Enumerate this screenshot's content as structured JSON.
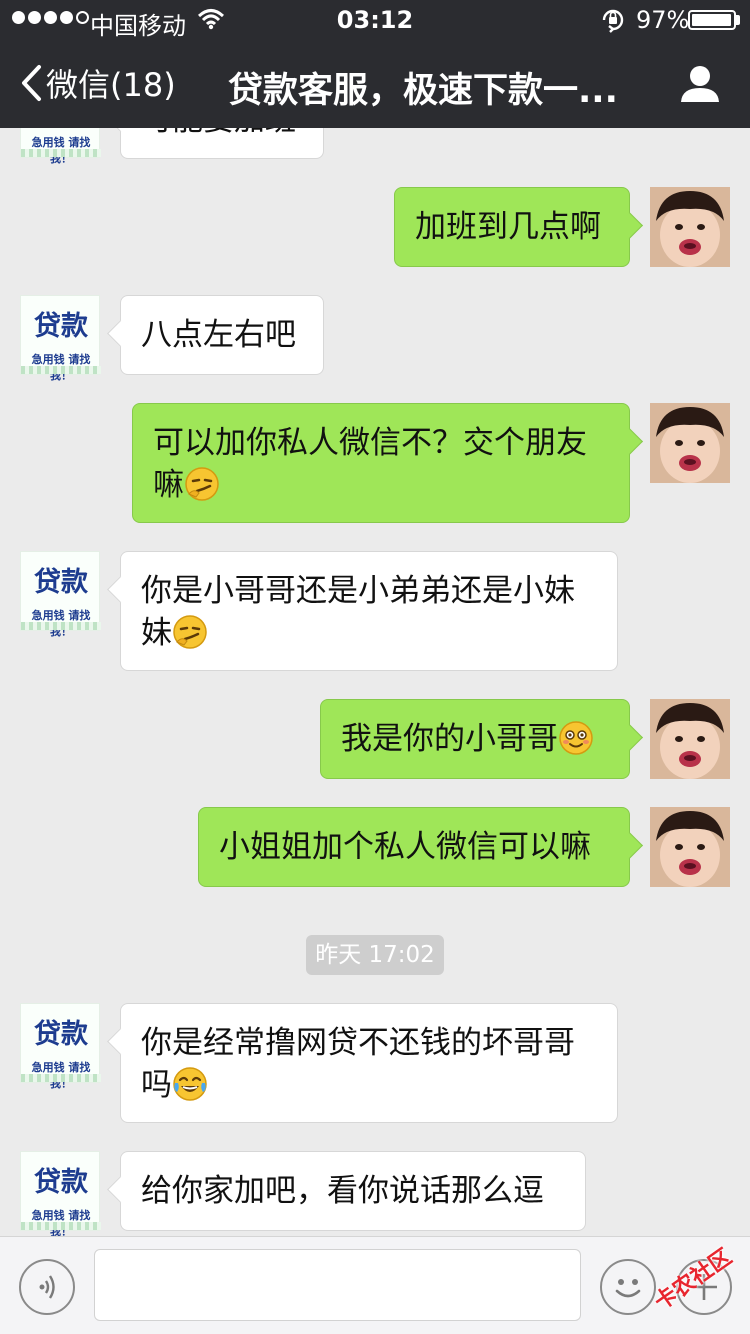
{
  "status_bar": {
    "carrier": "中国移动",
    "time": "03:12",
    "battery_percent": "97%",
    "battery_level": 0.97
  },
  "nav": {
    "back_label": "微信(18)",
    "title": "贷款客服，极速下款一..."
  },
  "loan_avatar": {
    "big_text": "贷款",
    "small_text": "急用钱 请找我！"
  },
  "messages": [
    {
      "side": "left",
      "text": "可能要加班"
    },
    {
      "side": "right",
      "text": "加班到几点啊"
    },
    {
      "side": "left",
      "text": "八点左右吧"
    },
    {
      "side": "right",
      "text": "可以加你私人微信不？交个朋友嘛",
      "emoji": "smirk-emoji"
    },
    {
      "side": "left",
      "text": "你是小哥哥还是小弟弟还是小妹妹",
      "emoji": "smirk-emoji"
    },
    {
      "side": "right",
      "text": "我是你的小哥哥",
      "emoji": "blush-emoji"
    },
    {
      "side": "right",
      "text": "小姐姐加个私人微信可以嘛"
    },
    {
      "side": "left",
      "text": "你是经常撸网贷不还钱的坏哥哥吗",
      "emoji": "tears-of-joy-emoji"
    },
    {
      "side": "left",
      "text": "给你家加吧，看你说话那么逗"
    }
  ],
  "timestamp": "昨天 17:02",
  "input": {
    "value": ""
  },
  "watermark": "卡农社区",
  "colors": {
    "nav_bg": "#2b2c30",
    "chat_bg": "#ebebeb",
    "sent_bubble": "#9fe658",
    "received_bubble": "#ffffff"
  }
}
